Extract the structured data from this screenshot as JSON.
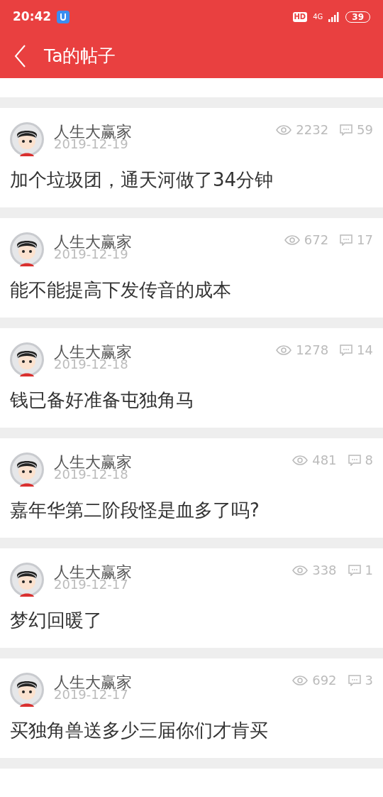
{
  "status_bar": {
    "time": "20:42",
    "hd": "HD",
    "network": "4G",
    "battery": "39"
  },
  "header": {
    "title": "Ta的帖子"
  },
  "posts": [
    {
      "author": "人生大赢家",
      "date": "2019-12-19",
      "views": "2232",
      "comments": "59",
      "text": "加个垃圾团，通天河做了34分钟"
    },
    {
      "author": "人生大赢家",
      "date": "2019-12-19",
      "views": "672",
      "comments": "17",
      "text": "能不能提高下发传音的成本"
    },
    {
      "author": "人生大赢家",
      "date": "2019-12-18",
      "views": "1278",
      "comments": "14",
      "text": "钱已备好准备屯独角马"
    },
    {
      "author": "人生大赢家",
      "date": "2019-12-18",
      "views": "481",
      "comments": "8",
      "text": "嘉年华第二阶段怪是血多了吗?"
    },
    {
      "author": "人生大赢家",
      "date": "2019-12-17",
      "views": "338",
      "comments": "1",
      "text": "梦幻回暖了"
    },
    {
      "author": "人生大赢家",
      "date": "2019-12-17",
      "views": "692",
      "comments": "3",
      "text": "买独角兽送多少三届你们才肯买"
    }
  ]
}
